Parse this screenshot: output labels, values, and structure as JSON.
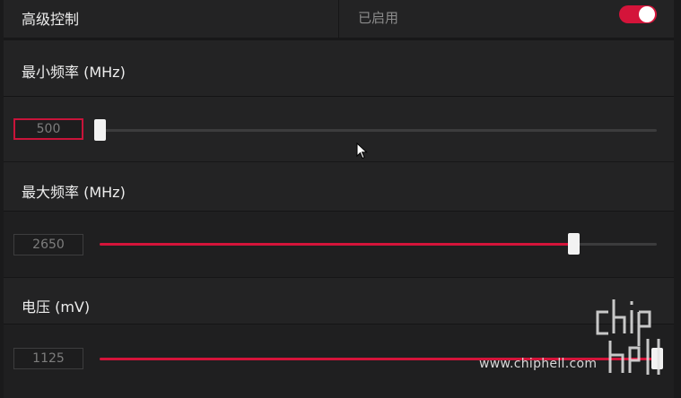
{
  "advanced_control": {
    "label": "高级控制",
    "status": "已启用",
    "toggle_on": true
  },
  "sliders": [
    {
      "id": "min-frequency",
      "label": "最小频率 (MHz)",
      "value": "500",
      "fill_fraction": 0.0,
      "focused": true
    },
    {
      "id": "max-frequency",
      "label": "最大频率 (MHz)",
      "value": "2650",
      "fill_fraction": 0.85,
      "focused": false
    },
    {
      "id": "voltage",
      "label": "电压 (mV)",
      "value": "1125",
      "fill_fraction": 1.0,
      "focused": false
    }
  ],
  "watermark": {
    "url": "www.chiphell.com"
  },
  "colors": {
    "accent": "#d4143a",
    "panel": "#232324",
    "body": "#1f1f20",
    "track": "#3c3c3d"
  },
  "icons": [
    "mouse-cursor-icon",
    "chiphell-logo-icon"
  ]
}
